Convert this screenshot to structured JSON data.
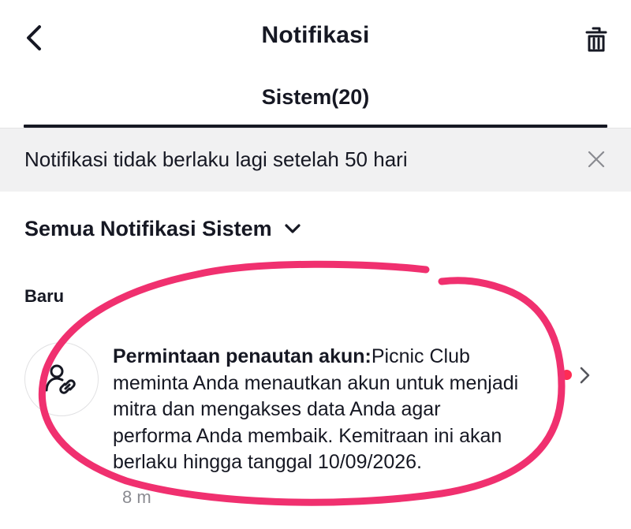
{
  "header": {
    "title": "Notifikasi",
    "back_icon": "chevron-left-icon",
    "trash_icon": "trash-icon"
  },
  "tab": {
    "label": "Sistem(20)"
  },
  "banner": {
    "text": "Notifikasi tidak berlaku lagi setelah 50 hari",
    "close_icon": "close-icon"
  },
  "filter": {
    "label": "Semua Notifikasi Sistem",
    "icon": "chevron-down-icon"
  },
  "section": {
    "label": "Baru"
  },
  "notification": {
    "icon": "account-link-icon",
    "title": "Permintaan penautan akun:",
    "body": "Picnic Club meminta Anda menautkan akun untuk menjadi mitra dan mengakses data Anda agar performa Anda membaik. Kemitraan ini akan berlaku hingga tanggal 10/09/2026.",
    "time": "8 m",
    "unread": true
  },
  "colors": {
    "text": "#161823",
    "banner_bg": "#f1f1f2",
    "unread_dot": "#fe2c55",
    "annotation": "#f0306f"
  }
}
